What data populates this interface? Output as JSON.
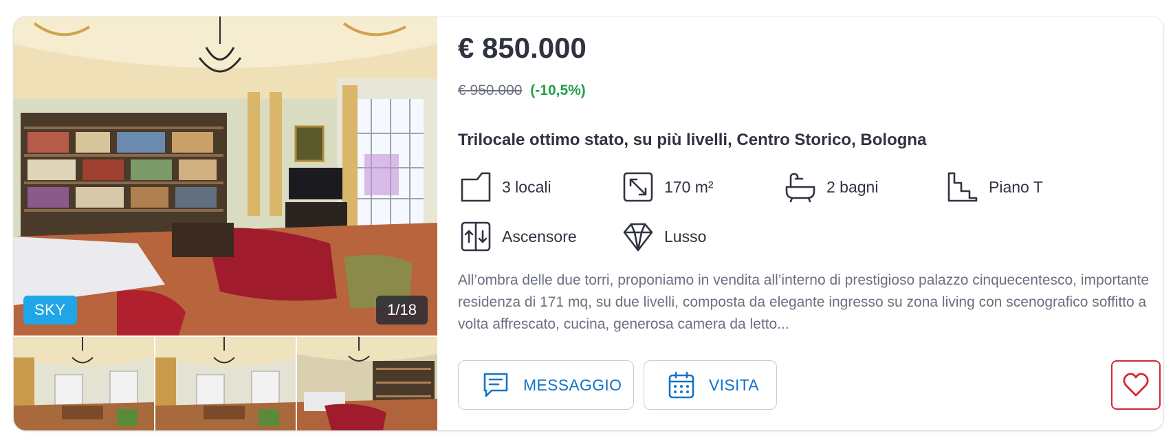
{
  "listing": {
    "price": "€ 850.000",
    "old_price": "€ 950.000",
    "discount": "(-10,5%)",
    "title": "Trilocale ottimo stato, su più livelli, Centro Storico, Bologna",
    "description": "All’ombra delle due torri, proponiamo in vendita all’interno di prestigioso palazzo cinquecentesco, importante residenza di 171 mq, su due livelli, composta da elegante ingresso su zona living con scenografico soffitto a volta affrescato, cucina, generosa camera da letto...",
    "features": [
      {
        "icon": "rooms-icon",
        "label": "3 locali"
      },
      {
        "icon": "area-icon",
        "label": "170 m²"
      },
      {
        "icon": "bathtub-icon",
        "label": "2 bagni"
      },
      {
        "icon": "stairs-icon",
        "label": "Piano T"
      },
      {
        "icon": "elevator-icon",
        "label": "Ascensore"
      },
      {
        "icon": "diamond-icon",
        "label": "Lusso"
      }
    ]
  },
  "gallery": {
    "badge": "SKY",
    "counter": "1/18",
    "thumbnail_count": 3
  },
  "actions": {
    "message_label": "MESSAGGIO",
    "message_icon": "chat-icon",
    "visit_label": "VISITA",
    "visit_icon": "calendar-icon",
    "favorite_icon": "heart-icon"
  },
  "colors": {
    "text": "#2f3340",
    "muted": "#6b7080",
    "discount": "#22a147",
    "accent_blue": "#1473c9",
    "badge_blue": "#20a6e8",
    "favorite_red": "#d42632"
  }
}
